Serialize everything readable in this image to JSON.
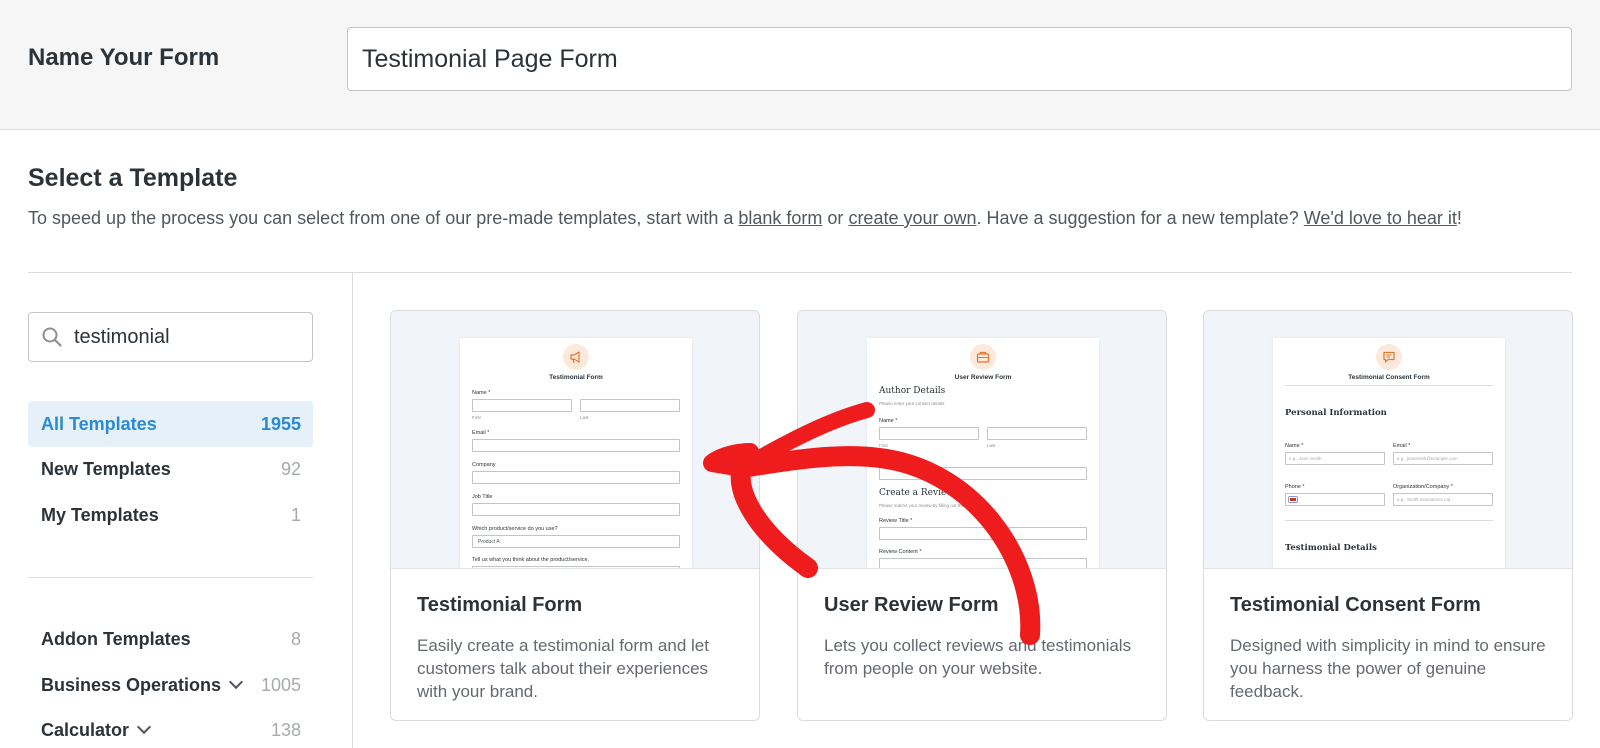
{
  "form_name": {
    "label": "Name Your Form",
    "value": "Testimonial Page Form"
  },
  "template_section": {
    "title": "Select a Template",
    "desc_part1": "To speed up the process you can select from one of our pre-made templates, start with a ",
    "link_blank": "blank form",
    "desc_or": " or ",
    "link_create": "create your own",
    "desc_part2": ". Have a suggestion for a new template? ",
    "link_love": "We'd love to hear it",
    "desc_end": "!"
  },
  "search": {
    "value": "testimonial"
  },
  "categories": [
    {
      "label": "All Templates",
      "count": "1955",
      "active": true
    },
    {
      "label": "New Templates",
      "count": "92"
    },
    {
      "label": "My Templates",
      "count": "1"
    },
    {
      "label": "Addon Templates",
      "count": "8"
    },
    {
      "label": "Business Operations",
      "count": "1005",
      "has_chevron": true
    },
    {
      "label": "Calculator",
      "count": "138",
      "has_chevron": true
    }
  ],
  "cards": [
    {
      "title": "Testimonial Form",
      "desc": "Easily create a testimonial form and let customers talk about their experiences with your brand.",
      "preview": {
        "icon": "megaphone-icon",
        "title": "Testimonial Form",
        "name_label": "Name *",
        "first": "First",
        "last": "Last",
        "email_label": "Email *",
        "company_label": "Company",
        "job_label": "Job Title",
        "product_label": "Which product/service do you use?",
        "product_value": "Product A",
        "tell_label": "Tell us what you think about the product/service."
      }
    },
    {
      "title": "User Review Form",
      "desc": "Lets you collect reviews and testimonials from people on your website.",
      "preview": {
        "icon": "briefcase-icon",
        "title": "User Review Form",
        "author_heading": "Author Details",
        "author_sub": "Please enter your contact details.",
        "name_label": "Name *",
        "first": "First",
        "last": "Last",
        "email_label": "Email *",
        "create_heading": "Create a Review",
        "create_sub": "Please submit your review by filling out the fields below.",
        "review_title_label": "Review Title *",
        "review_content_label": "Review Content *"
      }
    },
    {
      "title": "Testimonial Consent Form",
      "desc": "Designed with simplicity in mind to ensure you harness the power of genuine feedback.",
      "preview": {
        "icon": "chat-icon",
        "title": "Testimonial Consent Form",
        "personal_heading": "Personal Information",
        "name_label": "Name *",
        "name_ph": "e.g., Jane Smith",
        "email_label": "Email *",
        "email_ph": "e.g., janesmith@example.com",
        "phone_label": "Phone *",
        "org_label": "Organization/Company *",
        "org_ph": "e.g., Smith Innovations Ltd.",
        "details_heading": "Testimonial Details"
      }
    }
  ],
  "colors": {
    "accent": "#2a8ad2",
    "arrow": "#ee1c1c",
    "preview_icon": "#e27730"
  }
}
